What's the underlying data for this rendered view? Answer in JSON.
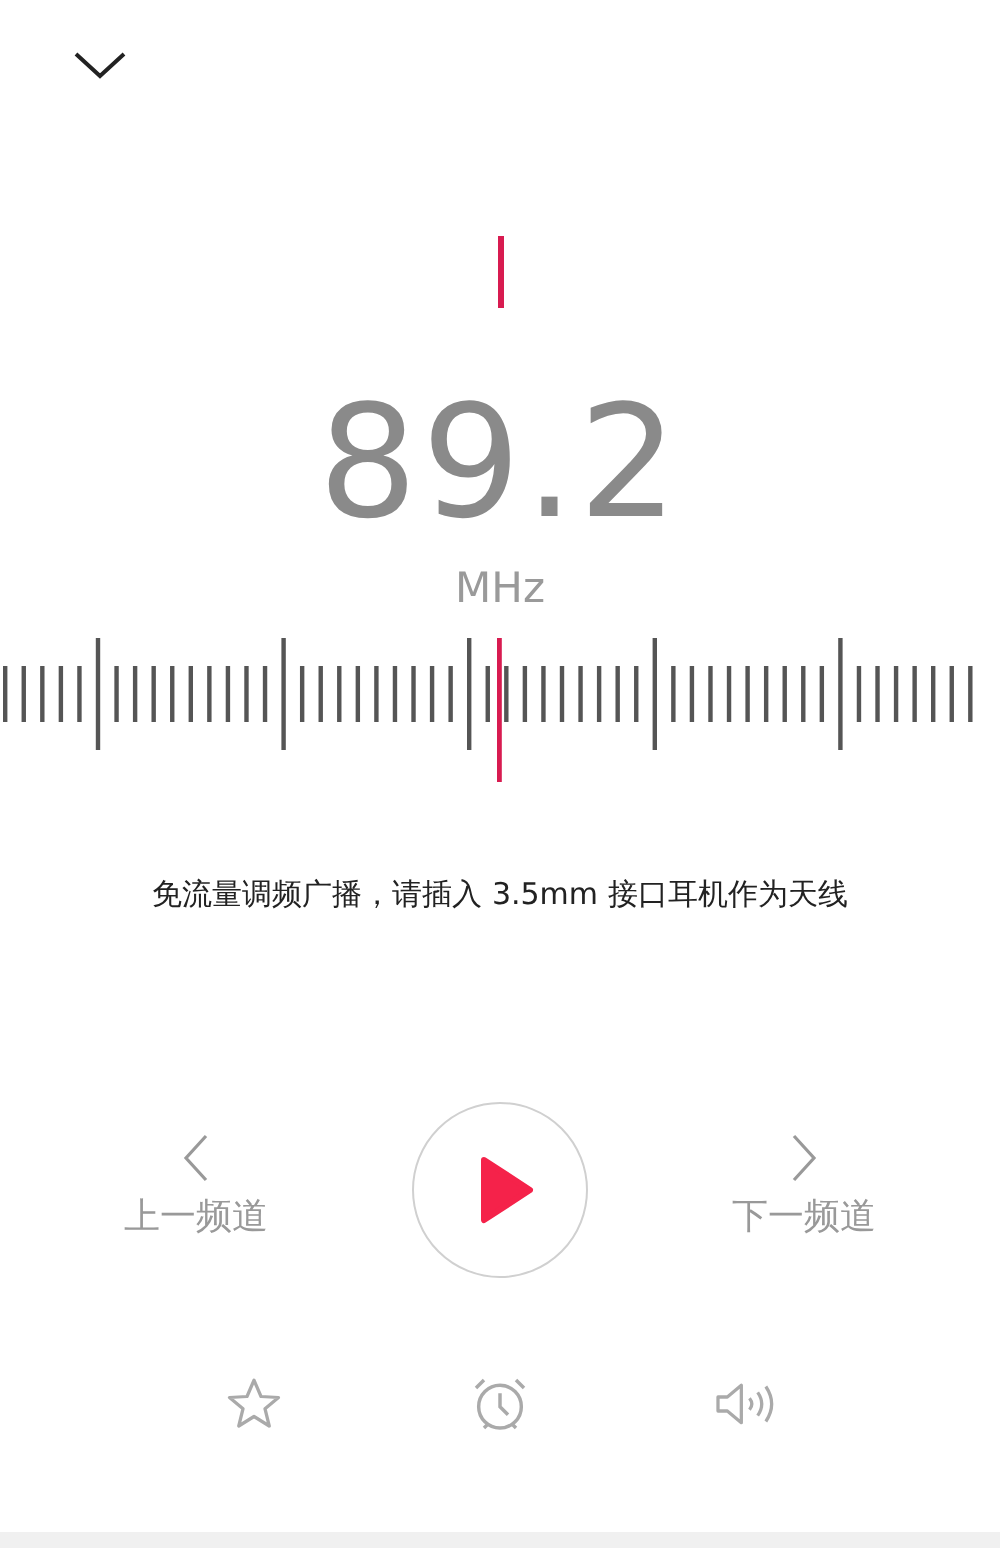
{
  "frequency": "89.2",
  "unit": "MHz",
  "hint": "免流量调频广播，请插入 3.5mm 接口耳机作为天线",
  "prev_label": "上一频道",
  "next_label": "下一频道",
  "playing": false
}
